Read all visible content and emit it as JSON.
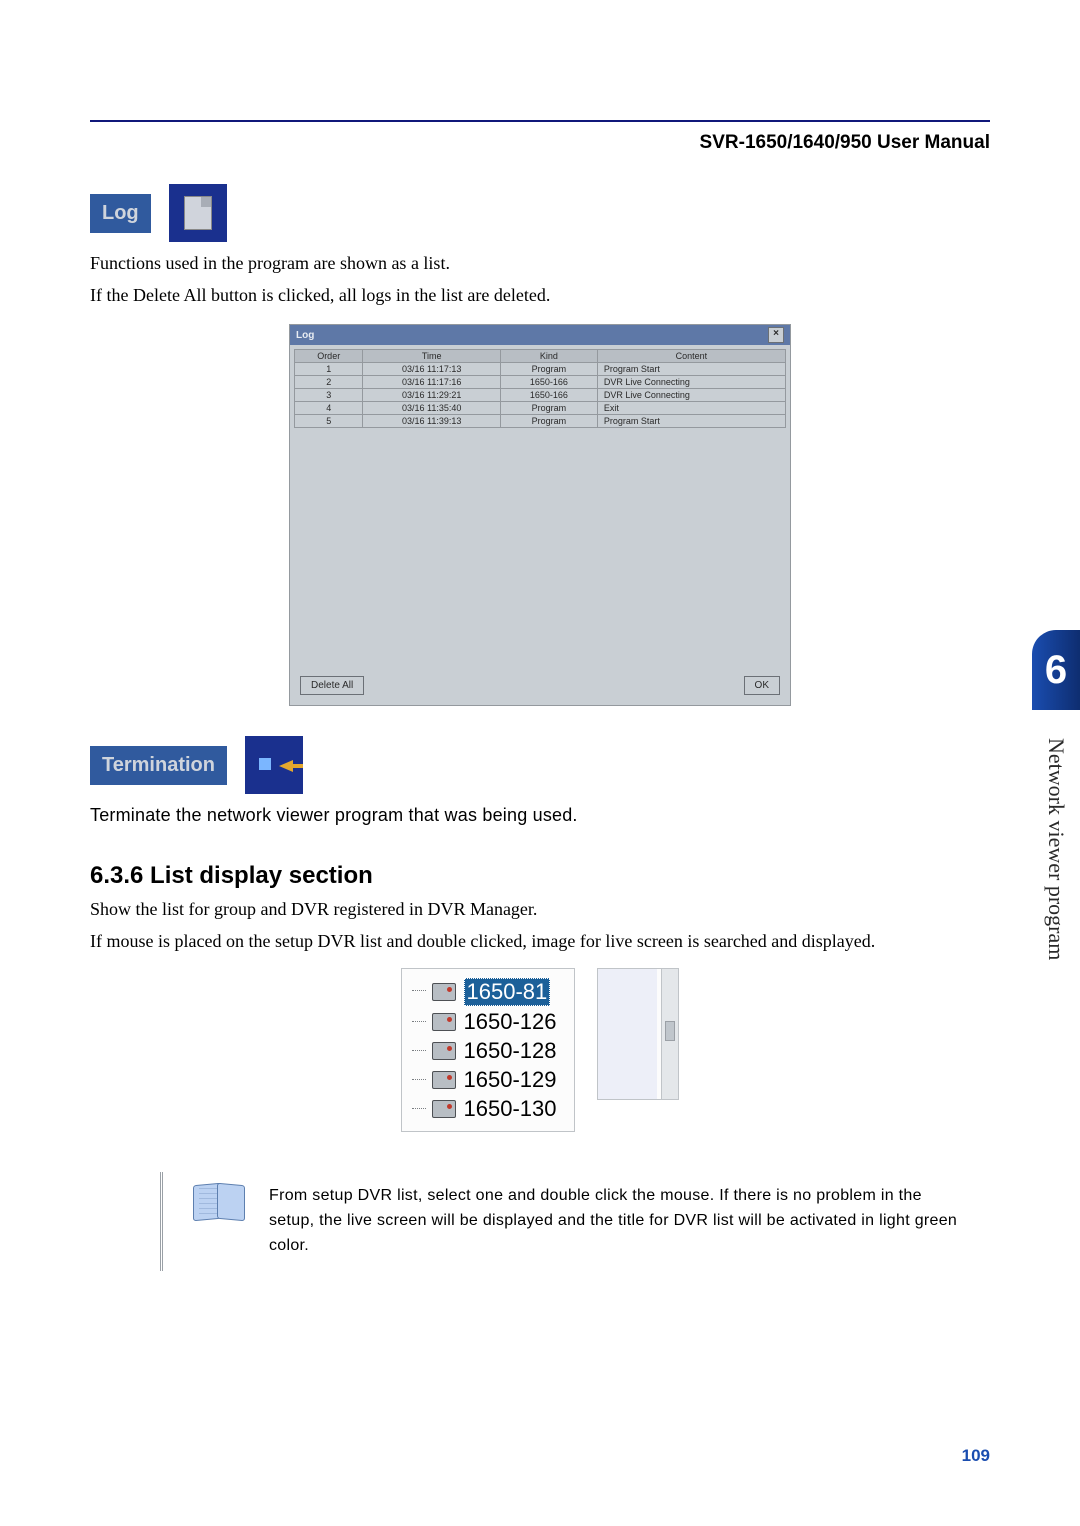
{
  "header": {
    "title": "SVR-1650/1640/950 User Manual"
  },
  "log_section": {
    "label": "Log",
    "text1": "Functions used in the program are shown as a list.",
    "text2": "If the Delete All button is clicked, all logs in the list are deleted.",
    "window": {
      "title": "Log",
      "headers": {
        "order": "Order",
        "time": "Time",
        "kind": "Kind",
        "content": "Content"
      },
      "rows": [
        {
          "order": "1",
          "time": "03/16 11:17:13",
          "kind": "Program",
          "content": "Program Start"
        },
        {
          "order": "2",
          "time": "03/16 11:17:16",
          "kind": "1650-166",
          "content": "DVR Live Connecting"
        },
        {
          "order": "3",
          "time": "03/16 11:29:21",
          "kind": "1650-166",
          "content": "DVR Live Connecting"
        },
        {
          "order": "4",
          "time": "03/16 11:35:40",
          "kind": "Program",
          "content": "Exit"
        },
        {
          "order": "5",
          "time": "03/16 11:39:13",
          "kind": "Program",
          "content": "Program Start"
        }
      ],
      "delete_all": "Delete All",
      "ok": "OK"
    }
  },
  "termination_section": {
    "label": "Termination",
    "text": "Terminate the network viewer program that was being used."
  },
  "list_display": {
    "heading": "6.3.6 List display section",
    "text1": "Show the list for group and DVR registered in DVR Manager.",
    "text2": "If mouse is placed on the setup DVR list and double clicked, image for live screen is searched and displayed.",
    "tree_items": [
      "1650-81",
      "1650-126",
      "1650-128",
      "1650-129",
      "1650-130"
    ],
    "selected_index": 0
  },
  "note": {
    "text": "From setup DVR list, select one and double click the mouse. If there is no problem in the setup, the live screen will be displayed and the title for DVR list will be activated in light green color."
  },
  "side_tab": {
    "number": "6",
    "caption": "Network viewer program"
  },
  "page_number": "109"
}
